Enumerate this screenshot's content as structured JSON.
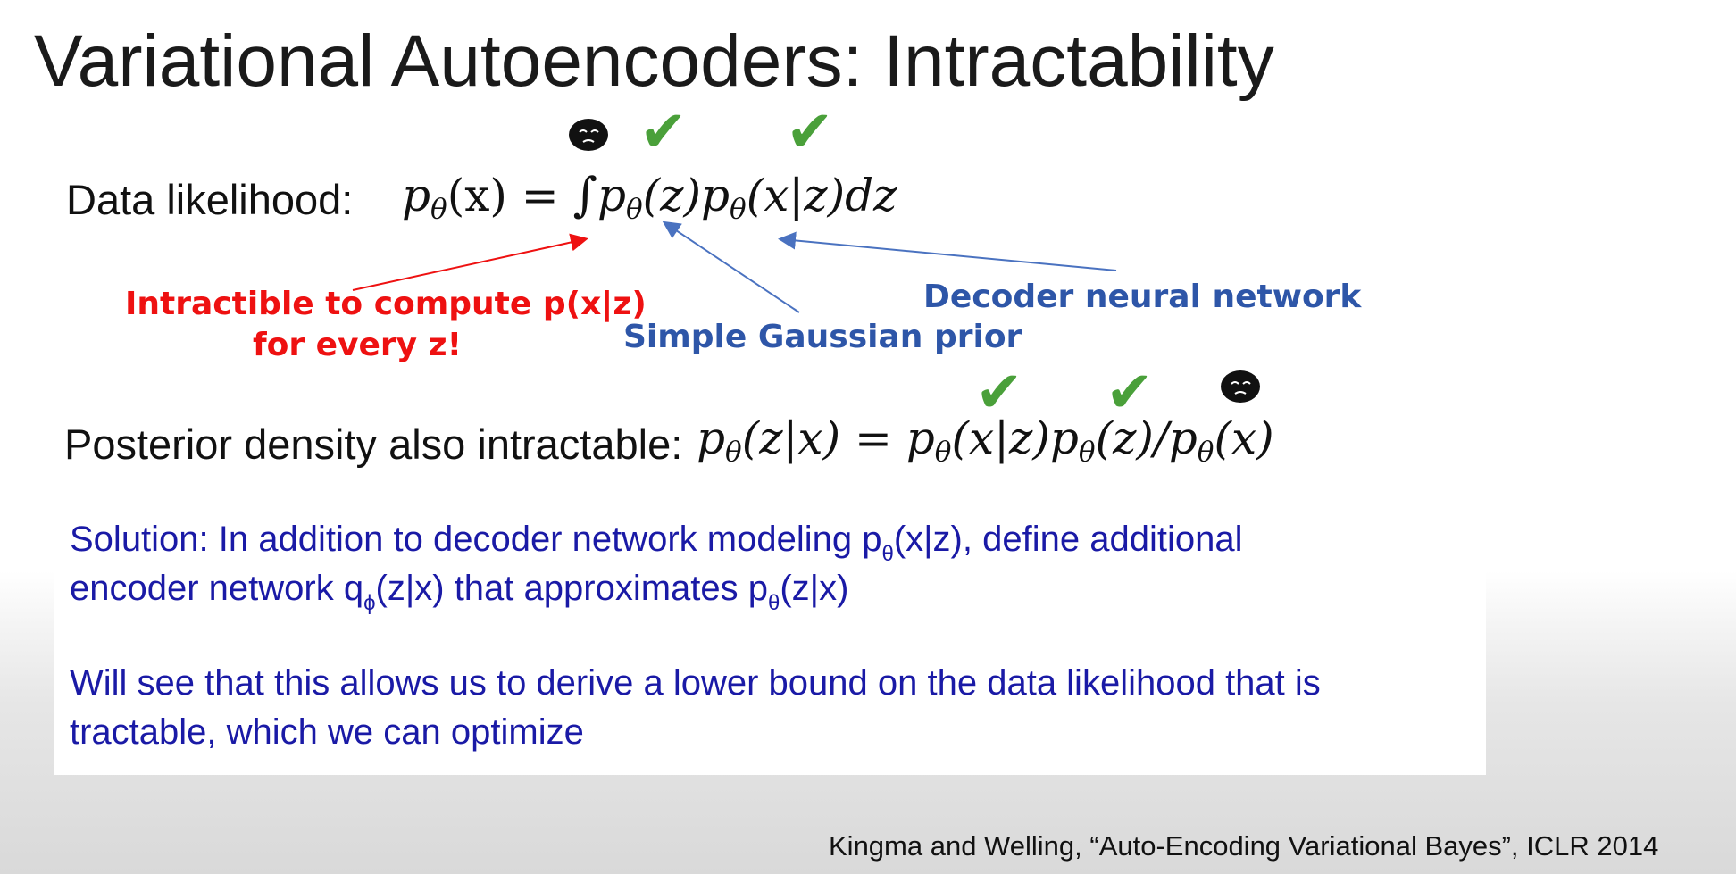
{
  "slide": {
    "title": "Variational Autoencoders: Intractability",
    "data_likelihood": {
      "label": "Data likelihood:",
      "eq_lhs": "p",
      "eq_lhs_sub": "θ",
      "eq_lhs_arg": "(x) = ",
      "eq_int": "∫",
      "eq_t1": "p",
      "eq_t1_sub": "θ",
      "eq_t1_arg": "(z)",
      "eq_t2": "p",
      "eq_t2_sub": "θ",
      "eq_t2_arg": "(x|z)dz"
    },
    "annotations": {
      "intractable_line1": "Intractible to compute p(x|z)",
      "intractable_line2": "for every z!",
      "gaussian_prior": "Simple Gaussian prior",
      "decoder": "Decoder neural network"
    },
    "posterior": {
      "label": "Posterior density also intractable:",
      "a": "p",
      "a_sub": "θ",
      "a_arg": "(z|x) = ",
      "b": "p",
      "b_sub": "θ",
      "b_arg": "(x|z)",
      "c": "p",
      "c_sub": "θ",
      "c_arg": "(z)/",
      "d": "p",
      "d_sub": "θ",
      "d_arg": "(x)"
    },
    "solution": {
      "l1_a": "Solution: In addition to decoder network modeling p",
      "l1_sub": "θ",
      "l1_b": "(x|z), define additional",
      "l2_a": "encoder network q",
      "l2_sub1": "ϕ",
      "l2_b": "(z|x) that approximates p",
      "l2_sub2": "θ",
      "l2_c": "(z|x)",
      "l3": "Will see that this allows us to derive a lower bound on the data likelihood that is",
      "l4": "tractable, which we can optimize"
    },
    "citation": "Kingma and Welling, “Auto-Encoding Variational Bayes”, ICLR 2014",
    "icons": {
      "check": "✔",
      "sad": "sad-face-icon"
    },
    "colors": {
      "red": "#ee1111",
      "blue_annotation": "#2e56a8",
      "blue_text": "#1a1aa6",
      "check_green": "#4aa03a"
    }
  }
}
